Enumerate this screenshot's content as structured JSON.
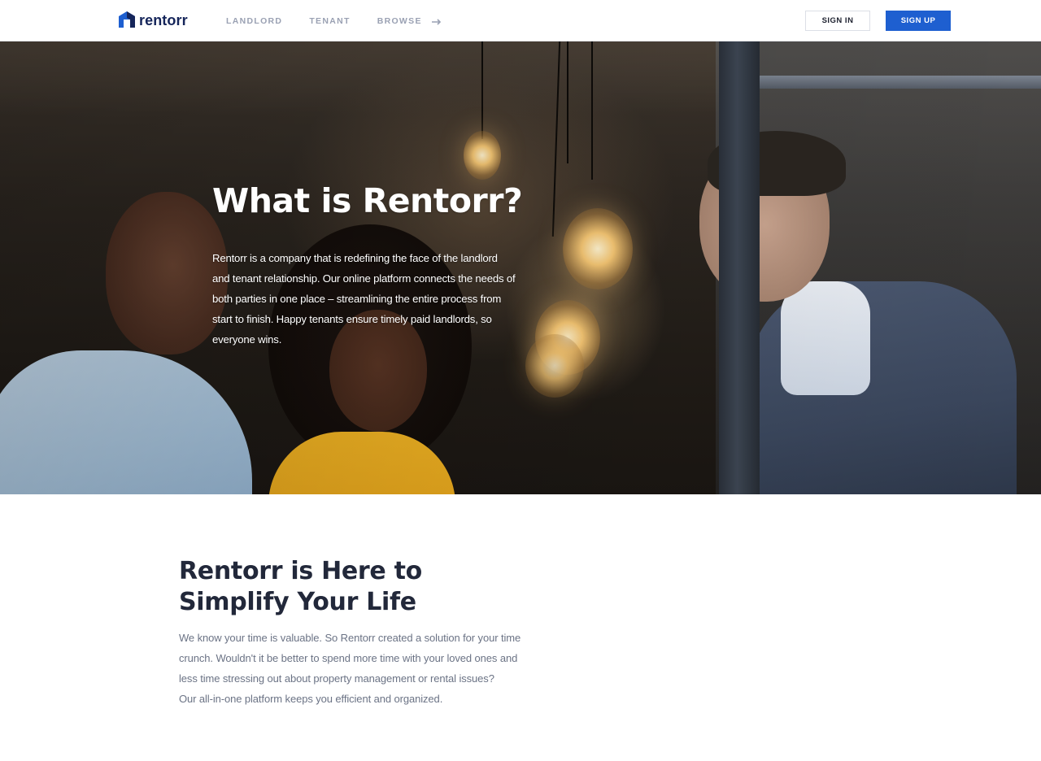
{
  "header": {
    "logo_text": "rentorr",
    "nav": [
      {
        "label": "LANDLORD"
      },
      {
        "label": "TENANT"
      },
      {
        "label": "BROWSE"
      }
    ],
    "sign_in_label": "SIGN IN",
    "sign_up_label": "SIGN UP"
  },
  "hero": {
    "title": "What is Rentorr?",
    "text": "Rentorr is a company that is redefining the face of the landlord and tenant relationship. Our online platform connects the needs of both parties in one place – streamlining the entire process from start to finish. Happy tenants ensure timely paid landlords, so everyone wins."
  },
  "simplify": {
    "title": "Rentorr is Here to Simplify Your Life",
    "lines": [
      "We know your time is valuable. So Rentorr created a solution for your time",
      "crunch. Wouldn't it be better to spend more time with your loved ones and",
      "less time stressing out about property management or rental issues?",
      "Our all-in-one platform keeps you efficient and organized."
    ]
  },
  "colors": {
    "brand_blue": "#1e5fd0",
    "logo_navy": "#15255a",
    "nav_gray": "#9aa1b3",
    "heading_dark": "#22283a",
    "body_gray": "#6b7385"
  },
  "icons": {
    "logo": "house-logo-icon",
    "browse": "arrow-right-icon"
  }
}
